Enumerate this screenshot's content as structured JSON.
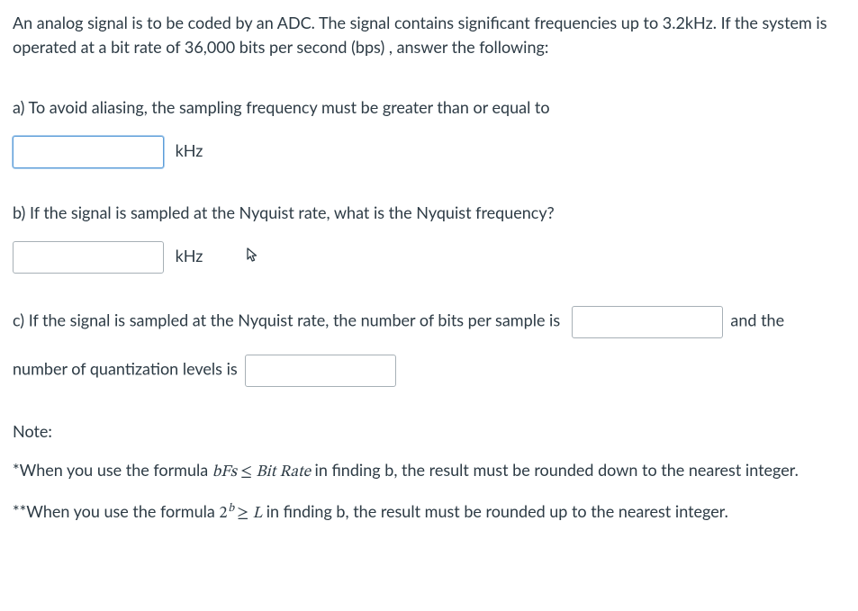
{
  "intro": "An analog signal is to be coded by an ADC.  The signal contains significant frequencies up to 3.2kHz.  If the system is operated at a bit rate of 36,000 bits per second (bps) , answer the following:",
  "parts": {
    "a": {
      "prompt": "a) To avoid aliasing, the sampling frequency must be greater than or equal to",
      "unit": "kHz"
    },
    "b": {
      "prompt": "b) If the signal is sampled at the Nyquist rate,  what is the Nyquist frequency?",
      "unit": "kHz"
    },
    "c": {
      "text_before_input1": "c) If the signal is sampled at the Nyquist rate, the number of bits per  sample is",
      "text_after_input1": " and the",
      "text_before_input2": "number of quantization levels is"
    }
  },
  "note": {
    "heading": "Note:",
    "line1_prefix": "*When you use the formula ",
    "line1_formula_b": "b",
    "line1_formula_Fs": "Fs",
    "line1_formula_op": " ≤ ",
    "line1_formula_rhs": "Bit Rate",
    "line1_suffix": "  in finding b, the result must be rounded down to the nearest integer.",
    "line2_prefix": "**When you use the formula ",
    "line2_formula_base": "2",
    "line2_formula_exp": "b",
    "line2_formula_op": " ≥ ",
    "line2_formula_rhs": "L",
    "line2_suffix": "  in finding b, the result must be rounded up to the nearest integer."
  }
}
